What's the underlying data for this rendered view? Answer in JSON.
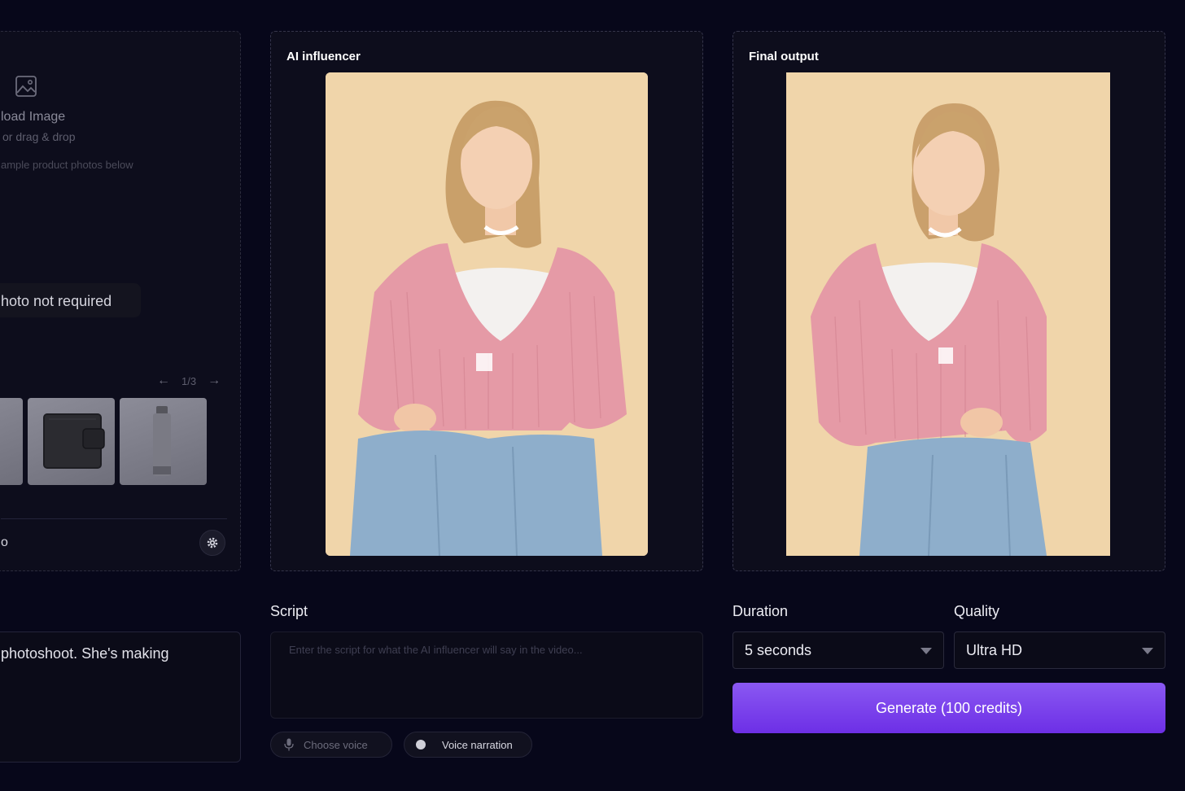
{
  "upload": {
    "title": "load Image",
    "subtitle": "or drag & drop",
    "hint": "ample product photos below",
    "photo_chip": "hoto not required",
    "pager": {
      "prev": "←",
      "indicator": "1/3",
      "next": "→"
    },
    "model_label": "o"
  },
  "cards": {
    "influencer_title": "AI influencer",
    "output_title": "Final output"
  },
  "script": {
    "label": "Script",
    "placeholder": "Enter the script for what the AI influencer will say in the video...",
    "choose_voice": "Choose voice",
    "voice_narration": "Voice narration"
  },
  "prompt": {
    "text": "photoshoot. She's making"
  },
  "settings": {
    "duration_label": "Duration",
    "duration_value": "5 seconds",
    "quality_label": "Quality",
    "quality_value": "Ultra HD"
  },
  "generate": {
    "label": "Generate (100 credits)"
  },
  "colors": {
    "background": "#07071a",
    "card": "#0d0d1c",
    "accent": "#7c3aed",
    "sweater": "#e59aa6",
    "jeans": "#8eaecb"
  }
}
